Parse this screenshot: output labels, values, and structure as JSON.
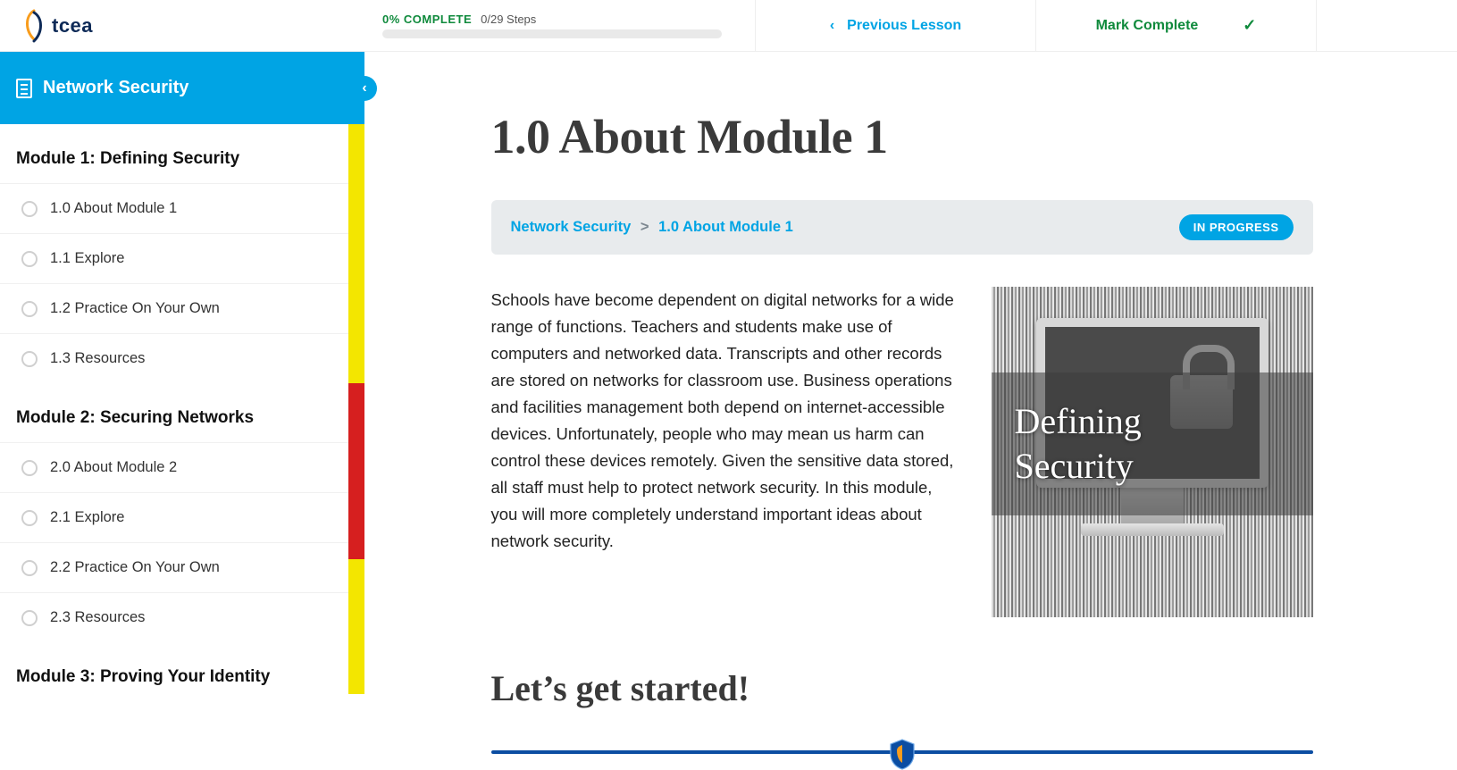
{
  "brand": {
    "name": "tcea"
  },
  "header": {
    "percent_complete_label": "0% COMPLETE",
    "steps_label": "0/29 Steps",
    "previous_lesson_label": "Previous Lesson",
    "mark_complete_label": "Mark Complete"
  },
  "sidebar": {
    "course_title": "Network Security",
    "modules": [
      {
        "title": "Module 1: Defining Security",
        "stripe_color": "yellow",
        "lessons": [
          {
            "label": "1.0 About Module 1"
          },
          {
            "label": "1.1 Explore"
          },
          {
            "label": "1.2 Practice On Your Own"
          },
          {
            "label": "1.3 Resources"
          }
        ]
      },
      {
        "title": "Module 2: Securing Networks",
        "stripe_color": "red_then_yellow",
        "lessons": [
          {
            "label": "2.0 About Module 2"
          },
          {
            "label": "2.1 Explore"
          },
          {
            "label": "2.2 Practice On Your Own"
          },
          {
            "label": "2.3 Resources"
          }
        ]
      },
      {
        "title": "Module 3: Proving Your Identity",
        "stripe_color": "yellow",
        "lessons": []
      }
    ]
  },
  "page": {
    "title": "1.0 About Module 1",
    "breadcrumb": {
      "root": "Network Security",
      "current": "1.0 About Module 1",
      "separator": ">"
    },
    "status_label": "IN PROGRESS",
    "paragraph": "Schools have become dependent on digital networks for a wide range of functions. Teachers and students make use of computers and networked data. Transcripts and other records are stored on networks for classroom use. Business operations and facilities management both depend on internet-accessible devices. Unfortunately, people who may mean us harm can control these devices remotely. Given the sensitive data stored, all staff must help to protect network security. In this module, you will more completely understand important ideas about network security.",
    "hero_overlay_line1": "Defining",
    "hero_overlay_line2": "Security",
    "subheading": "Let’s get started!"
  }
}
